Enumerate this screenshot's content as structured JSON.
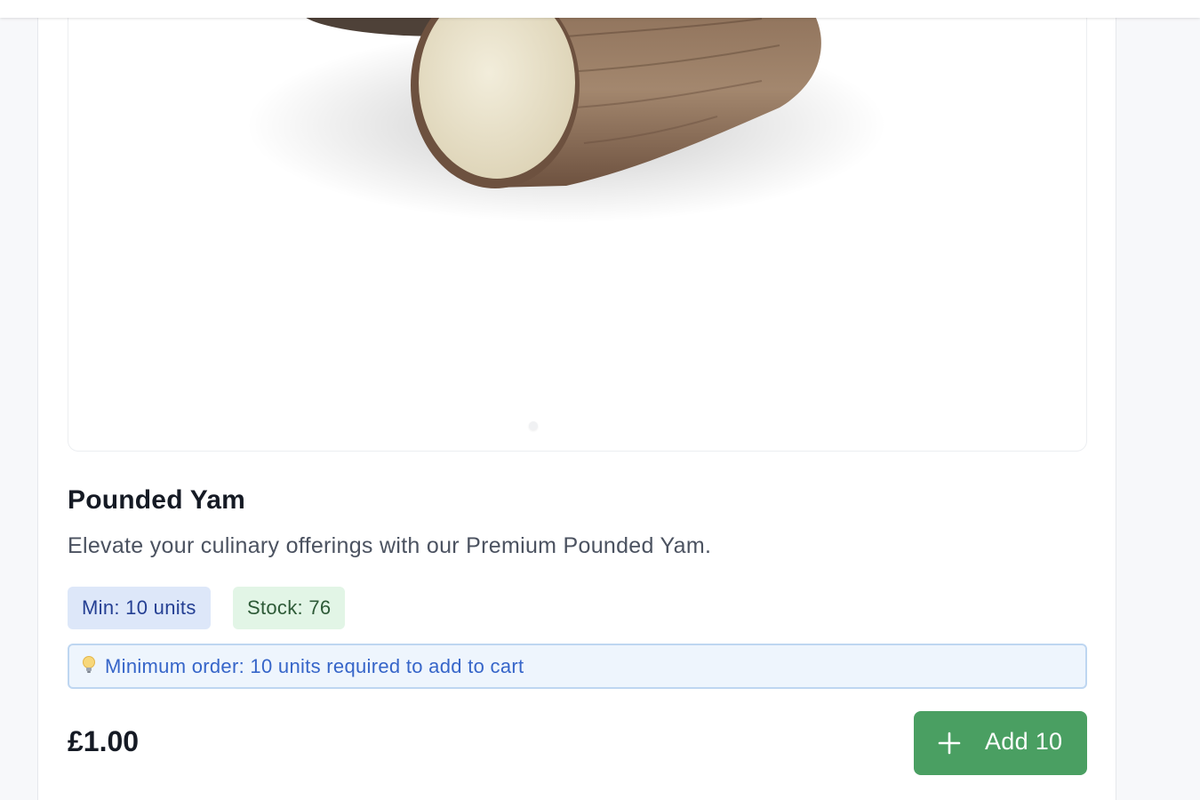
{
  "product": {
    "name": "Pounded Yam",
    "description": "Elevate your culinary offerings with our Premium Pounded Yam.",
    "badges": {
      "min": "Min: 10 units",
      "stock": "Stock: 76"
    },
    "notice": "Minimum order: 10 units required to add to cart",
    "price": "£1.00",
    "add_button_label": "Add 10"
  },
  "icons": {
    "notice_icon": "lightbulb-icon",
    "button_icon": "plus-icon"
  },
  "colors": {
    "button": "#4a9f62",
    "min_badge_bg": "#dde7f9",
    "stock_badge_bg": "#e2f5e6",
    "notice_bg": "#eef5fd"
  }
}
